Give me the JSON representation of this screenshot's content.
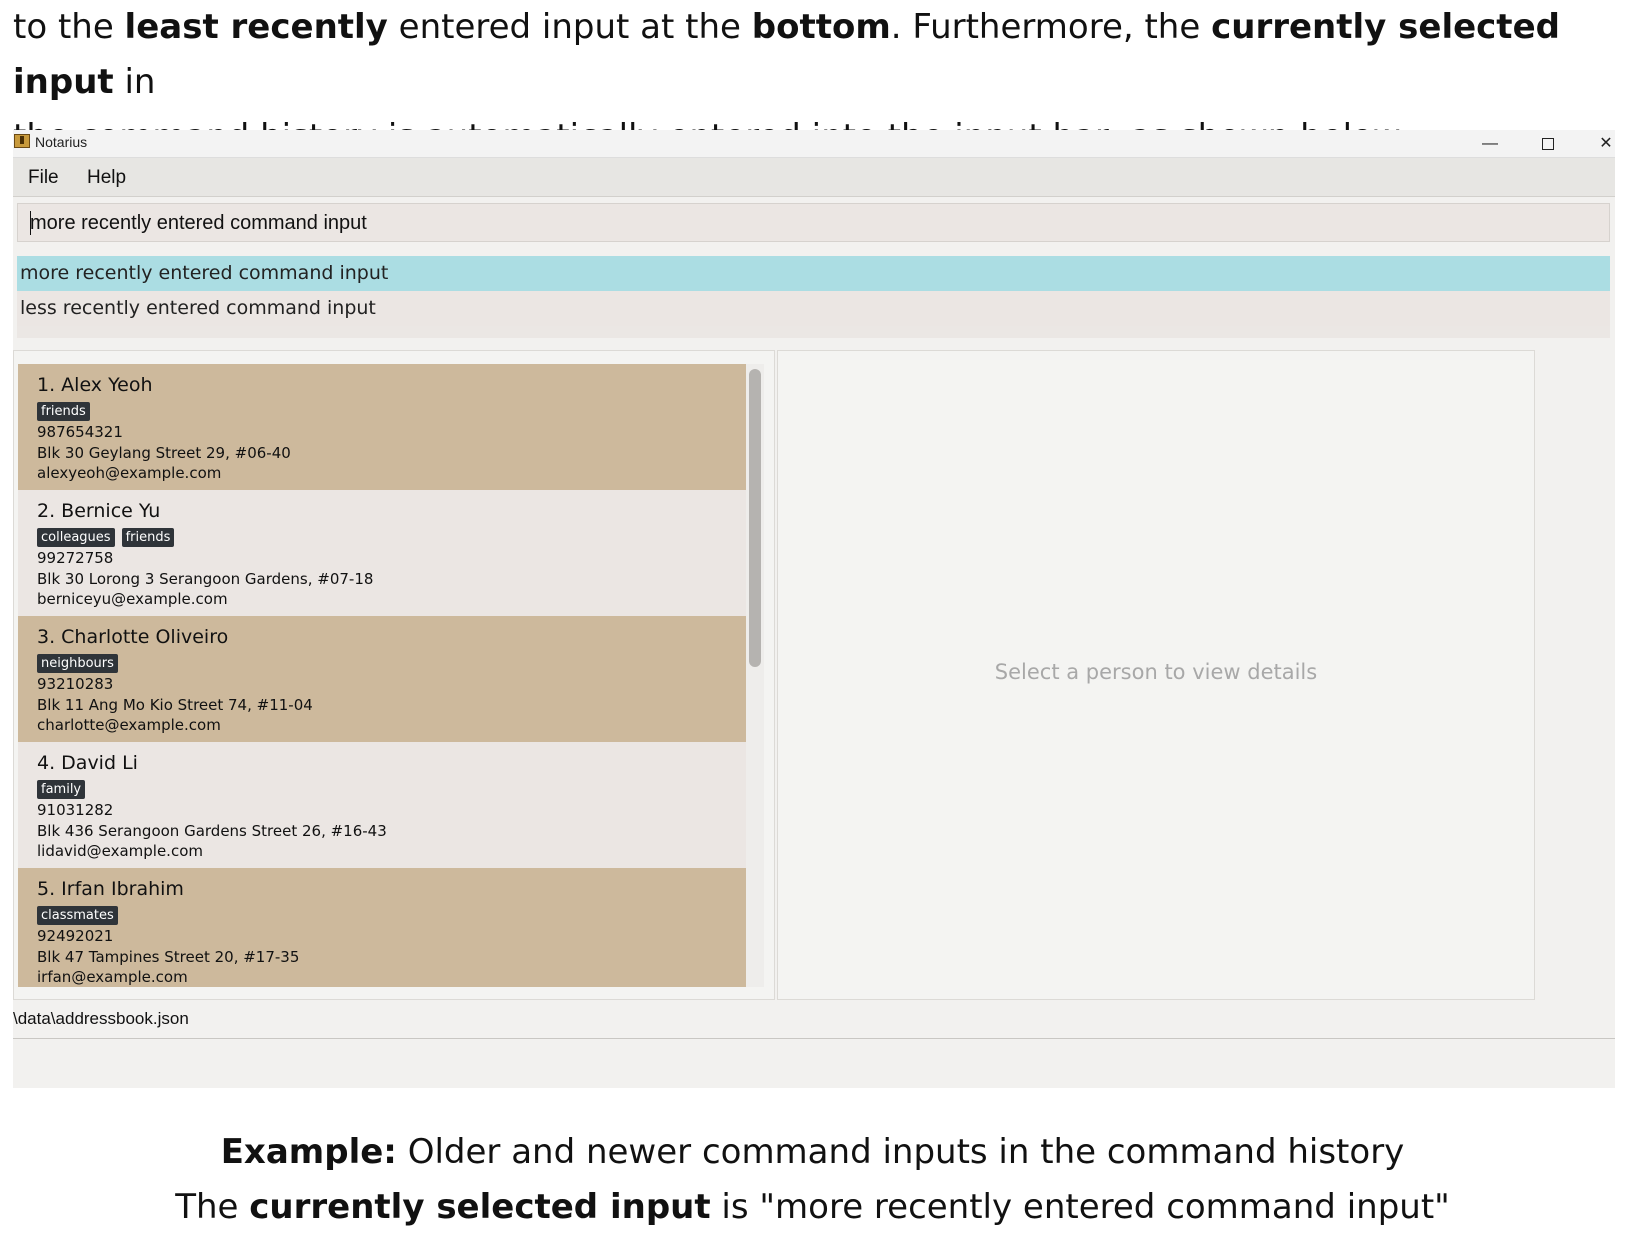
{
  "intro": {
    "line1_a": "to the ",
    "line1_b": "least recently",
    "line1_c": " entered input at the ",
    "line1_d": "bottom",
    "line1_e": ". Furthermore, the ",
    "line1_f": "currently selected input",
    "line1_g": " in",
    "line2": "the command history is automatically entered into the input bar, as shown below:"
  },
  "window": {
    "title": "Notarius",
    "controls": {
      "minimize": "—",
      "close": "✕"
    }
  },
  "menu": [
    "File",
    "Help"
  ],
  "command_box": {
    "value": "more recently entered command input"
  },
  "history": [
    {
      "text": "more recently entered command input",
      "selected": true
    },
    {
      "text": "less recently entered command input",
      "selected": false
    }
  ],
  "persons": [
    {
      "name": "1. Alex Yeoh",
      "tags": [
        "friends"
      ],
      "phone": "987654321",
      "address": "Blk 30 Geylang Street 29, #06-40",
      "email": "alexyeoh@example.com"
    },
    {
      "name": "2. Bernice Yu",
      "tags": [
        "colleagues",
        "friends"
      ],
      "phone": "99272758",
      "address": "Blk 30 Lorong 3 Serangoon Gardens, #07-18",
      "email": "berniceyu@example.com"
    },
    {
      "name": "3. Charlotte Oliveiro",
      "tags": [
        "neighbours"
      ],
      "phone": "93210283",
      "address": "Blk 11 Ang Mo Kio Street 74, #11-04",
      "email": "charlotte@example.com"
    },
    {
      "name": "4. David Li",
      "tags": [
        "family"
      ],
      "phone": "91031282",
      "address": "Blk 436 Serangoon Gardens Street 26, #16-43",
      "email": "lidavid@example.com"
    },
    {
      "name": "5. Irfan Ibrahim",
      "tags": [
        "classmates"
      ],
      "phone": "92492021",
      "address": "Blk 47 Tampines Street 20, #17-35",
      "email": "irfan@example.com"
    }
  ],
  "detail": {
    "placeholder": "Select a person to view details"
  },
  "status": {
    "path": "\\data\\addressbook.json"
  },
  "caption": {
    "line1_bold": "Example:",
    "line1_rest": " Older and newer command inputs in the command history",
    "line2_a": "The ",
    "line2_bold": "currently selected input",
    "line2_rest": " is \"more recently entered command input\""
  },
  "colors": {
    "card_odd": "#cdb99c",
    "card_even": "#ebe6e3",
    "history_selected": "#abdde3",
    "tag_bg": "#2f3439"
  }
}
